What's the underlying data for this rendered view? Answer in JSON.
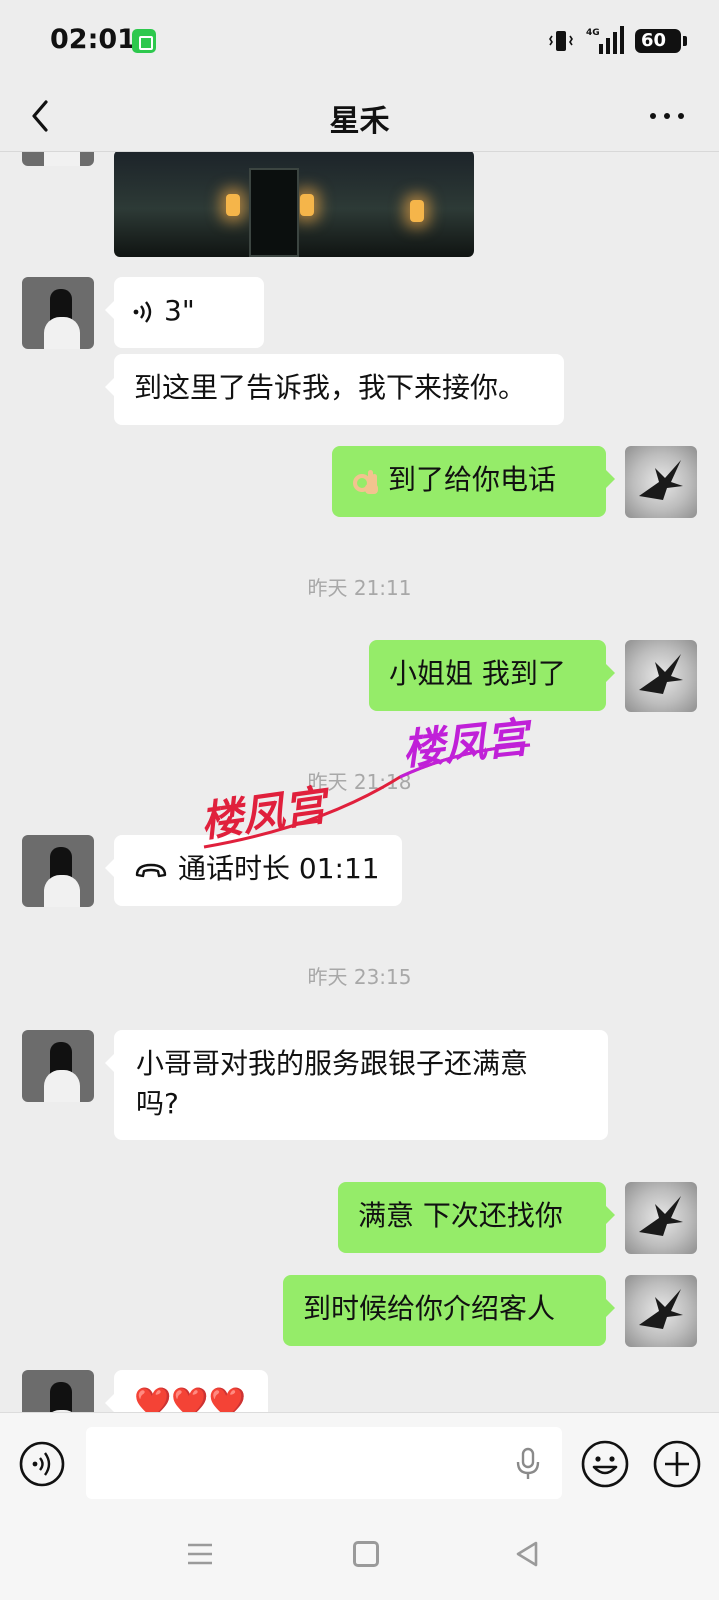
{
  "status_bar": {
    "time": "02:01",
    "network": "4G",
    "battery": "60"
  },
  "header": {
    "title": "星禾",
    "back_icon": "chevron-left-icon",
    "more_icon": "more-dots-icon"
  },
  "messages": {
    "m1": {
      "sender": "contact",
      "type": "image"
    },
    "m2": {
      "sender": "contact",
      "type": "voice",
      "duration": "3\""
    },
    "m3": {
      "sender": "contact",
      "type": "text",
      "text": "到这里了告诉我，我下来接你。"
    },
    "m4": {
      "sender": "me",
      "type": "text",
      "emoji": "ok-hand-emoji",
      "text": "到了给你电话"
    },
    "t1": "昨天 21:11",
    "m5": {
      "sender": "me",
      "type": "text",
      "text": "小姐姐 我到了"
    },
    "t2": "昨天 21:18",
    "m6": {
      "sender": "contact",
      "type": "call",
      "text": "通话时长 01:11"
    },
    "t3": "昨天 23:15",
    "m7": {
      "sender": "contact",
      "type": "text",
      "line1": "小哥哥对我的服务跟银子还满意",
      "line2": "吗?"
    },
    "m8": {
      "sender": "me",
      "type": "text",
      "text": "满意 下次还找你"
    },
    "m9": {
      "sender": "me",
      "type": "text",
      "text": "到时候给你介绍客人"
    },
    "m10": {
      "sender": "contact",
      "type": "emoji",
      "text": "❤️❤️❤️"
    }
  },
  "watermark": {
    "text_left": "楼凤宫",
    "text_right": "楼凤宫",
    "color_left": "#e0203c",
    "color_right": "#c020d8"
  },
  "input_bar": {
    "placeholder": "",
    "icons": [
      "voice-mode-icon",
      "microphone-icon",
      "emoji-icon",
      "plus-icon"
    ]
  },
  "colors": {
    "background": "#ededed",
    "my_bubble": "#95ec69",
    "their_bubble": "#ffffff",
    "timestamp": "#a8a8a8"
  }
}
